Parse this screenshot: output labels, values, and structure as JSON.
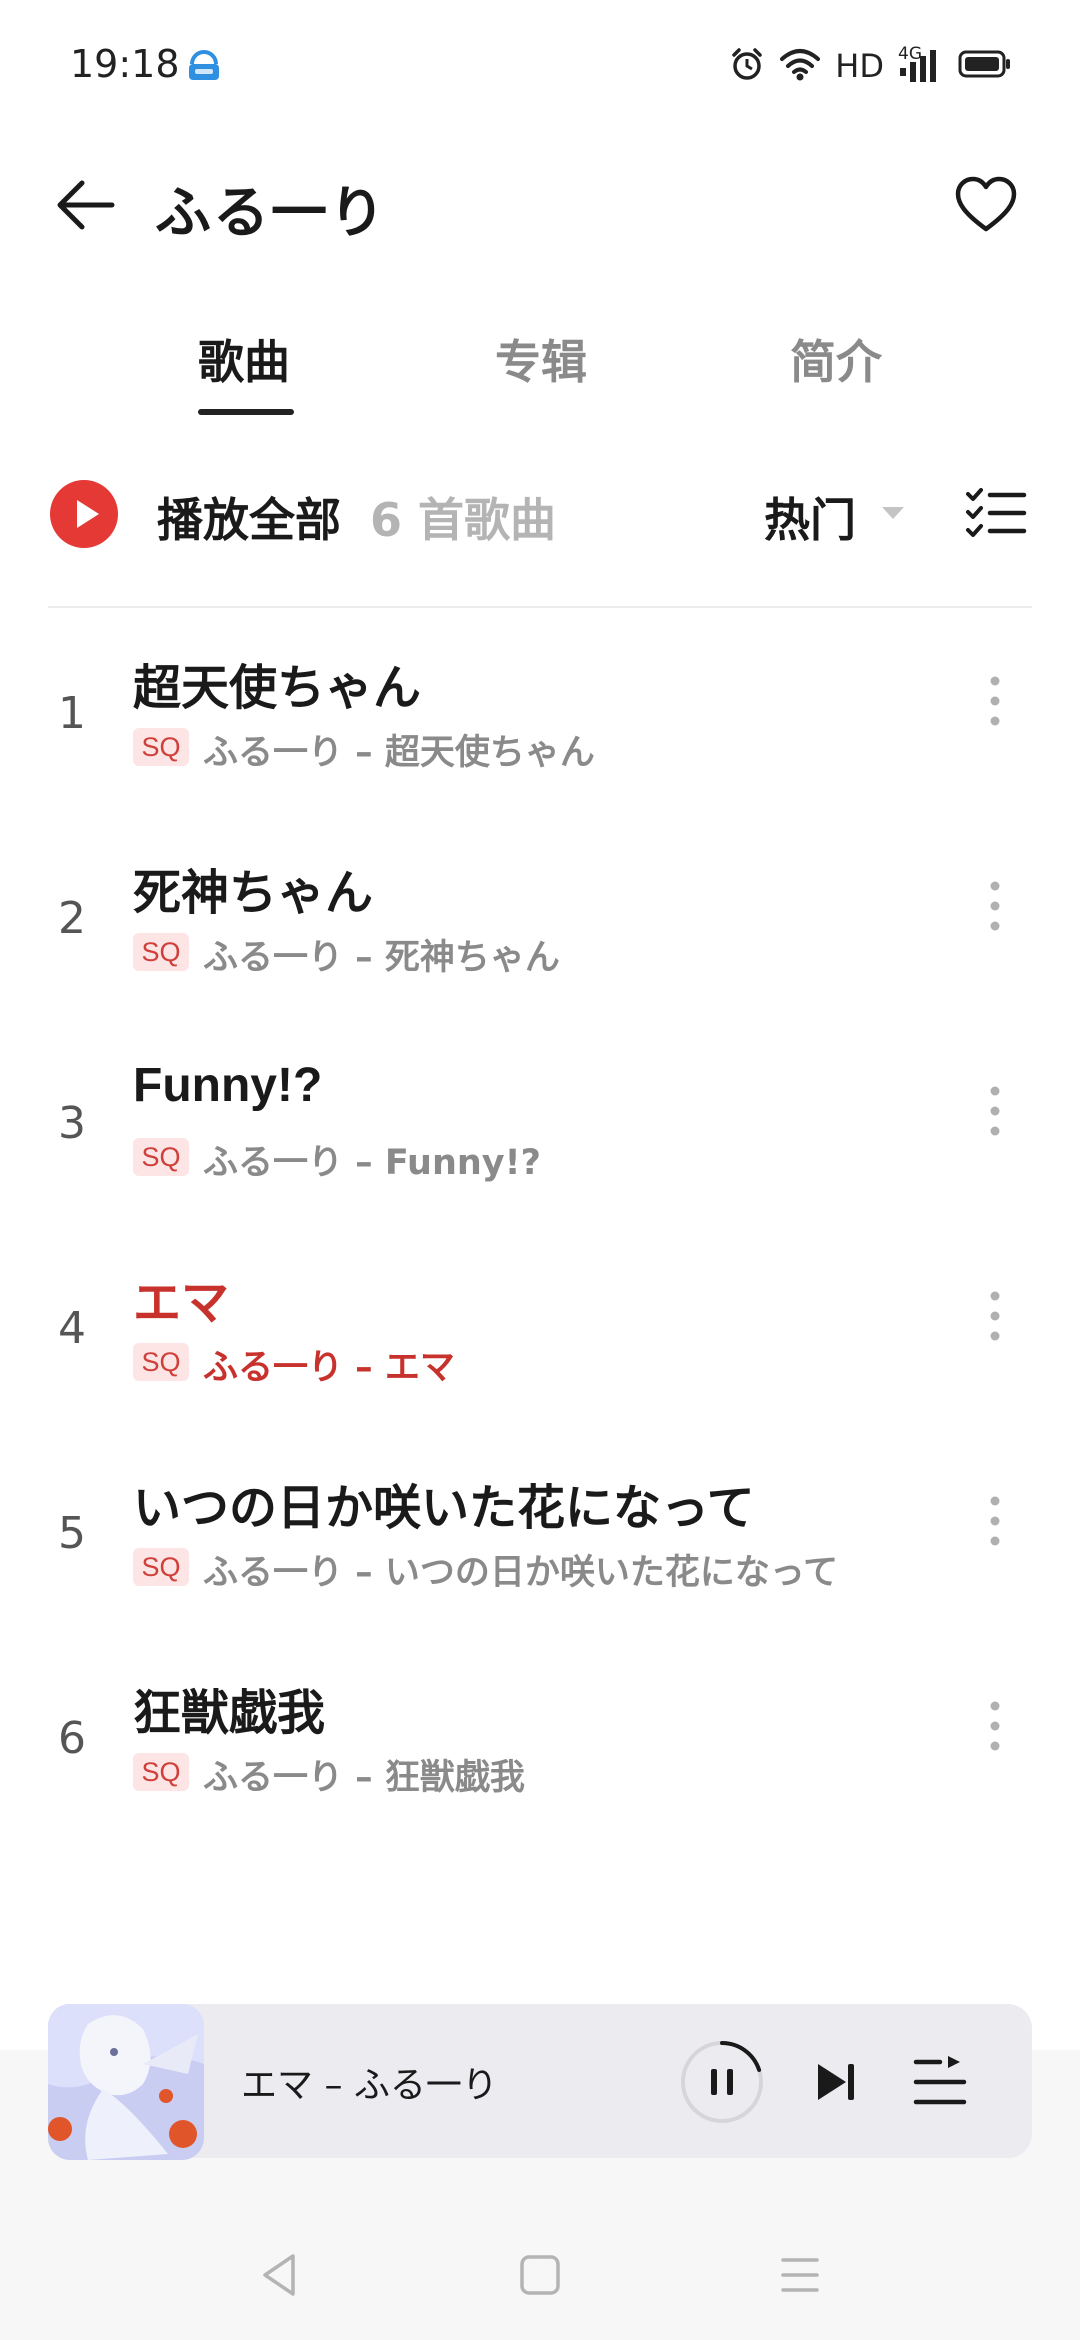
{
  "status_bar": {
    "time": "19:18",
    "hd_label": "HD",
    "network_label": "4G",
    "icons": [
      "app-notification-icon",
      "alarm-icon",
      "wifi-icon",
      "signal-icon",
      "battery-icon"
    ]
  },
  "header": {
    "title": "ふる一り",
    "back_icon": "back-arrow-icon",
    "favorite_icon": "heart-icon"
  },
  "tabs": [
    {
      "label": "歌曲",
      "active": true
    },
    {
      "label": "专辑",
      "active": false
    },
    {
      "label": "简介",
      "active": false
    }
  ],
  "play_bar": {
    "play_all_label": "播放全部",
    "song_count": "6 首歌曲",
    "sort_label": "热门"
  },
  "songs": [
    {
      "num": "1",
      "title": "超天使ちゃん",
      "badge": "SQ",
      "subtitle": "ふる一り – 超天使ちゃん",
      "playing": false
    },
    {
      "num": "2",
      "title": "死神ちゃん",
      "badge": "SQ",
      "subtitle": "ふる一り – 死神ちゃん",
      "playing": false
    },
    {
      "num": "3",
      "title": "Funny!?",
      "badge": "SQ",
      "subtitle": "ふる一り – Funny!?",
      "playing": false
    },
    {
      "num": "4",
      "title": "エマ",
      "badge": "SQ",
      "subtitle": "ふる一り – エマ",
      "playing": true
    },
    {
      "num": "5",
      "title": "いつの日か咲いた花になって",
      "badge": "SQ",
      "subtitle": "ふる一り – いつの日か咲いた花になって",
      "playing": false
    },
    {
      "num": "6",
      "title": "狂獣戯我",
      "badge": "SQ",
      "subtitle": "ふる一り – 狂獣戯我",
      "playing": false
    }
  ],
  "mini_player": {
    "now_playing": "エマ – ふる一り",
    "progress": 0.2
  },
  "colors": {
    "accent": "#e53935",
    "playing_text": "#c8322d",
    "badge_bg": "#fde5e5"
  }
}
